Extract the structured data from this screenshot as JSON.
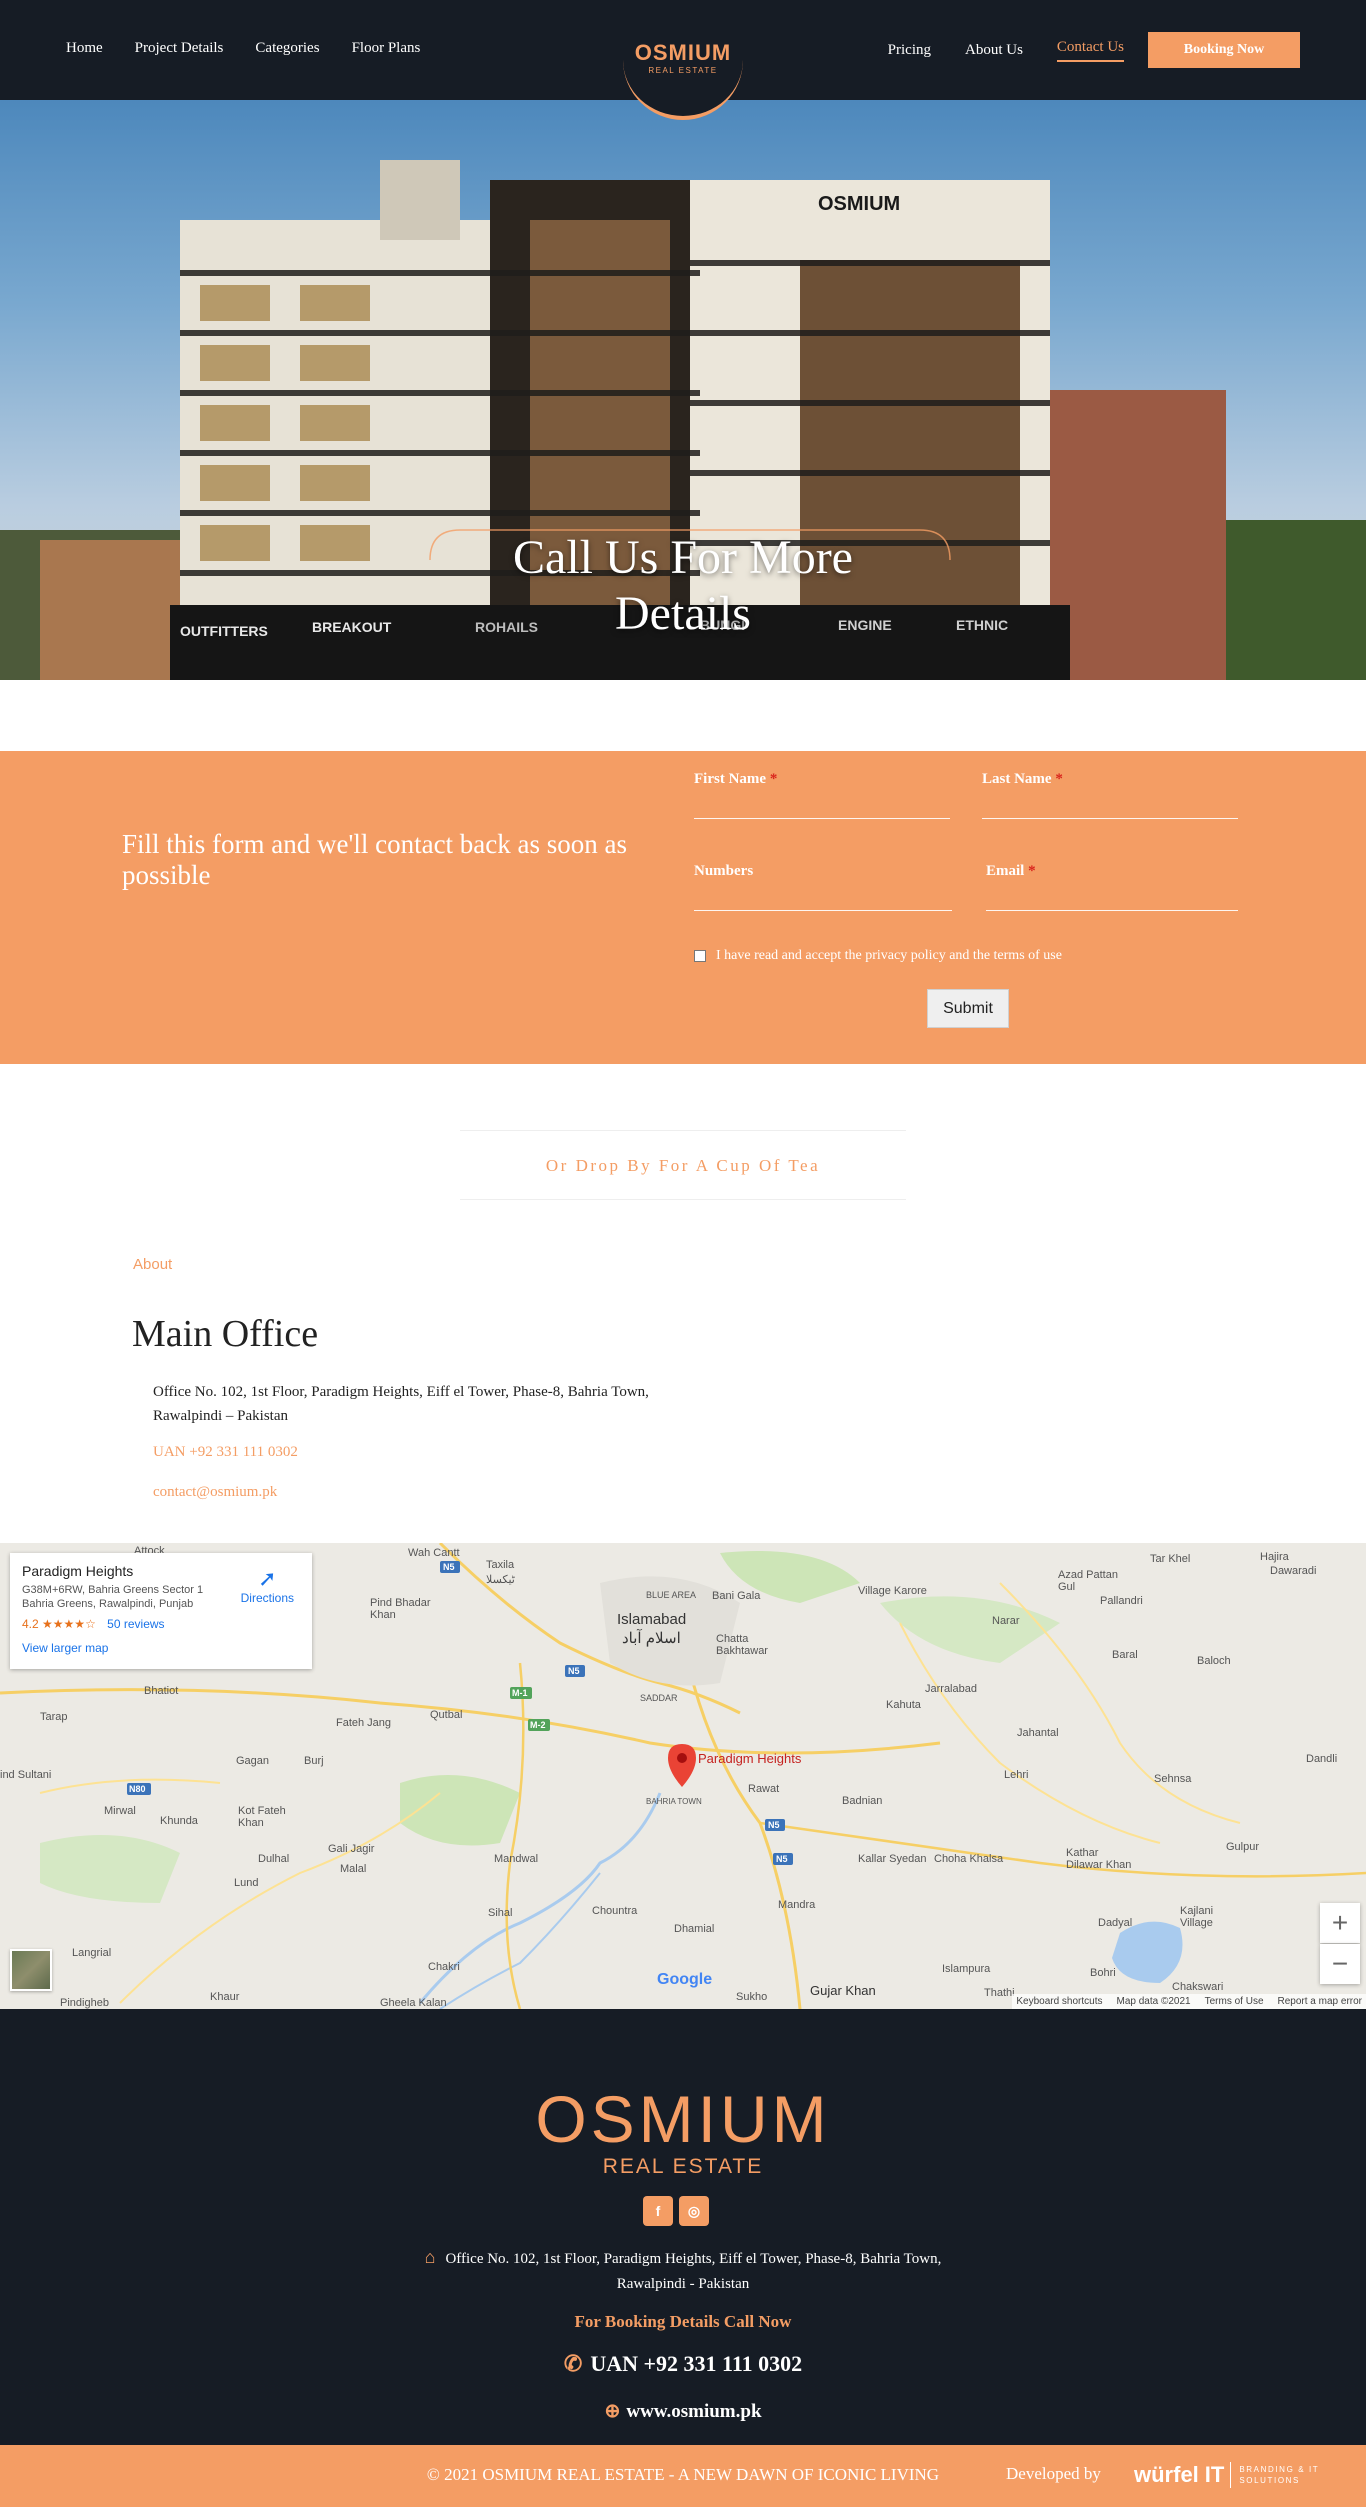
{
  "nav": {
    "left": [
      "Home",
      "Project Details",
      "Categories",
      "Floor Plans"
    ],
    "right": [
      "Pricing",
      "About Us",
      "Contact Us"
    ],
    "booking": "Booking Now",
    "logo": "OSMIUM",
    "logo_sub": "REAL ESTATE"
  },
  "hero": {
    "title_line1": "Call Us For More",
    "title_line2": "Details",
    "building_sign": "OSMIUM",
    "shop_signs": [
      "OUTFITTERS",
      "BREAKOUT",
      "ROHAILS",
      "BUNGI",
      "ENGINE",
      "ETHNIC"
    ]
  },
  "form": {
    "intro": "Fill this form and we'll contact back as soon as possible",
    "first_name": "First Name",
    "last_name": "Last Name",
    "numbers": "Numbers",
    "email": "Email",
    "required_mark": "*",
    "consent": "I have read and accept the privacy policy and the terms of use",
    "submit": "Submit"
  },
  "tea": "Or Drop By For A Cup Of Tea",
  "office": {
    "about": "About",
    "title": "Main Office",
    "address": "Office No. 102, 1st Floor, Paradigm Heights, Eiff el Tower, Phase-8, Bahria Town, Rawalpindi – Pakistan",
    "phone": "UAN +92 331 111 0302",
    "email": "contact@osmium.pk"
  },
  "map": {
    "place": "Paradigm Heights",
    "address": "G38M+6RW, Bahria Greens Sector 1 Bahria Greens, Rawalpindi, Punjab",
    "rating": "4.2",
    "stars": "★★★★☆",
    "reviews": "50 reviews",
    "larger": "View larger map",
    "directions": "Directions",
    "pin_label": "Paradigm Heights",
    "zoom_in": "+",
    "zoom_out": "−",
    "google": "Google",
    "footer": [
      "Keyboard shortcuts",
      "Map data ©2021",
      "Terms of Use",
      "Report a map error"
    ],
    "labels": {
      "wah": "Wah Cantt",
      "taxila": "Taxila",
      "taxila_ur": "ٹیکسلا",
      "attock": "Attock",
      "islamabad": "Islamabad",
      "islamabad_ur": "اسلام آباد",
      "blue_area": "BLUE AREA",
      "bani_gala": "Bani Gala",
      "chatta": "Chatta Bakhtawar",
      "village_karore": "Village Karore",
      "tar_khel": "Tar Khel",
      "hajira": "Hajira",
      "dawaradi": "Dawaradi",
      "azad": "Azad Pattan Gul",
      "pallandri": "Pallandri",
      "narar": "Narar",
      "pind_bhadar": "Pind Bhadar Khan",
      "bhatiot": "Bhatiot",
      "saddar": "SADDAR",
      "jarralabad": "Jarralabad",
      "baral": "Baral",
      "baloch": "Baloch",
      "kahuta": "Kahuta",
      "tarap": "Tarap",
      "fateh": "Fateh Jang",
      "qutbal": "Qutbal",
      "jahantal": "Jahantal",
      "dandli": "Dandli",
      "gagan": "Gagan",
      "burj": "Burj",
      "lehri": "Lehri",
      "sehnsa": "Sehnsa",
      "sultani": "ind Sultani",
      "rawat": "Rawat",
      "badnian": "Badnian",
      "mirwal": "Mirwal",
      "khunda": "Khunda",
      "kot": "Kot Fateh Khan",
      "bahria": "BAHRIA TOWN",
      "gali": "Gali Jagir",
      "mandwal": "Mandwal",
      "dulhal": "Dulhal",
      "malal": "Malal",
      "kallar": "Kallar Syedan",
      "choha": "Choha Khalsa",
      "kathar": "Kathar Dilawar Khan",
      "gulpur": "Gulpur",
      "lund": "Lund",
      "sihal": "Sihal",
      "chountra": "Chountra",
      "dhamial": "Dhamial",
      "mandra": "Mandra",
      "dadyal": "Dadyal",
      "kajlani": "Kajlani Village",
      "langrial": "Langrial",
      "chakri": "Chakri",
      "islampura": "Islampura",
      "pindigheb": "Pindigheb",
      "khaur": "Khaur",
      "gheela": "Gheela Kalan",
      "sukho": "Sukho",
      "gujar": "Gujar Khan",
      "thathi": "Thathi",
      "bohri": "Bohri",
      "chakswari": "Chakswari"
    },
    "road_shields": [
      "N5",
      "M-1",
      "M-2",
      "N5",
      "N5",
      "N80",
      "N5"
    ]
  },
  "footer": {
    "logo": "OSMIUM",
    "logo_sub": "REAL ESTATE",
    "address": "Office No. 102, 1st Floor, Paradigm Heights, Eiff el Tower, Phase-8, Bahria Town, Rawalpindi - Pakistan",
    "booking_title": "For Booking Details Call Now",
    "phone": "UAN +92 331 111 0302",
    "website": "www.osmium.pk",
    "copyright": "© 2021 OSMIUM REAL ESTATE - A NEW DAWN OF ICONIC LIVING",
    "developed_by": "Developed by",
    "dev_brand": "würfel",
    "dev_it": "IT",
    "dev_line1": "BRANDING & IT",
    "dev_line2": "SOLUTIONS"
  },
  "colors": {
    "accent": "#f49d64",
    "dark": "#161c25",
    "link": "#1a73e8"
  }
}
